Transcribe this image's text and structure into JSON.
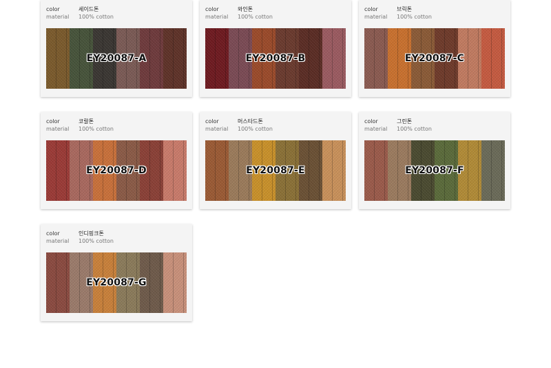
{
  "labels": {
    "color": "color",
    "material": "material"
  },
  "swatches": [
    {
      "color": "세이드톤",
      "material": "100% cotton",
      "code": "EY20087-A",
      "stripes": [
        "#7a5a2c",
        "#46533a",
        "#3a3632",
        "#7a5a55",
        "#6e3a3c",
        "#5e3228"
      ]
    },
    {
      "color": "와인톤",
      "material": "100% cotton",
      "code": "EY20087-B",
      "stripes": [
        "#6e1a20",
        "#7a4a54",
        "#9a4a2a",
        "#6a3a2e",
        "#5a2c24",
        "#9a5a60"
      ]
    },
    {
      "color": "브릭톤",
      "material": "100% cotton",
      "code": "EY20087-C",
      "stripes": [
        "#8a5a50",
        "#c8702e",
        "#8a5a36",
        "#6e3a2a",
        "#c07a60",
        "#c45a40"
      ]
    },
    {
      "color": "코랄톤",
      "material": "100% cotton",
      "code": "EY20087-D",
      "stripes": [
        "#9a3a36",
        "#a8685e",
        "#c8703a",
        "#8a5a46",
        "#8a4036",
        "#c87a6a"
      ]
    },
    {
      "color": "머스타드톤",
      "material": "100% cotton",
      "code": "EY20087-E",
      "stripes": [
        "#9a5a34",
        "#9a7a5a",
        "#c8902a",
        "#8a7036",
        "#6a5034",
        "#c8905a"
      ]
    },
    {
      "color": "그린톤",
      "material": "100% cotton",
      "code": "EY20087-F",
      "stripes": [
        "#9a5a4a",
        "#9a7a5e",
        "#4a4a30",
        "#5a6a3a",
        "#b08a36",
        "#6a6a58"
      ]
    },
    {
      "color": "인디핑크톤",
      "material": "100% cotton",
      "code": "EY20087-G",
      "stripes": [
        "#8a4a40",
        "#9a7a6a",
        "#c8803a",
        "#8a7a5a",
        "#6e5a4a",
        "#c8907a"
      ]
    }
  ]
}
